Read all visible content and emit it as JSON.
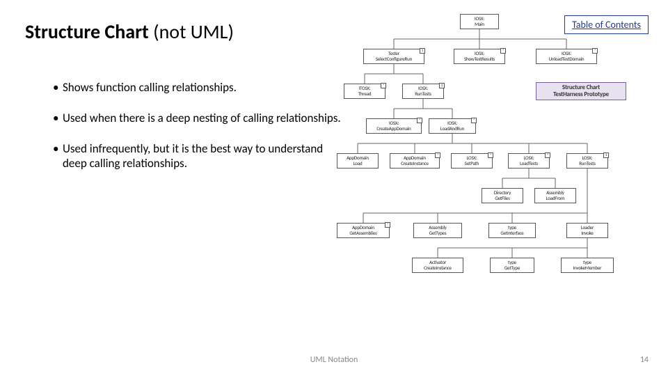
{
  "header": {
    "title_bold": "Structure Chart",
    "title_rest": " (not UML)"
  },
  "toc": {
    "label": "Table of Contents"
  },
  "bullets": [
    "Shows function calling relationships.",
    "Used when there is a deep nesting of calling relationships.",
    "Used infrequently, but it is the best way to understand deep calling relationships."
  ],
  "nodes": {
    "r0_main": "IOSX:<br>Main",
    "r1_a": "Tester<br>SelectConfigureRun",
    "r1_b": "IOSX:<br>ShowTestResults",
    "r1_c": "IOSX:<br>UnloadTestDomain",
    "r2_a": "ITOSX:<br>Thread",
    "r2_b": "IOSX:<br>RunTests",
    "r2_hl": "Structure Chart<br>TestHarness Prototype",
    "r3_a": "IOSX:<br>CreateAppDomain",
    "r3_b": "IOSX:<br>LoadAndRun",
    "r4_a": "AppDomain<br>Load",
    "r4_b": "AppDomain<br>CreateInstance",
    "r4_c": "LOSX:<br>SetPath",
    "r4_d": "LOSX:<br>LoadTests",
    "r4_e": "LOSX:<br>RunTests",
    "r5_a": "Directory<br>GetFiles",
    "r5_b": "Assembly<br>LoadFrom",
    "r6_a": "AppDomain<br>GetAssemblies",
    "r6_b": "Assembly<br>GetTypes",
    "r6_c": "type<br>GetInterface",
    "r6_d": "Loader<br>Invoke",
    "r7_a": "Activator<br>CreateInstance",
    "r7_b": "type<br>GetType",
    "r7_c": "type<br>InvokeMember"
  },
  "footer": {
    "center": "UML Notation",
    "page": "14"
  }
}
